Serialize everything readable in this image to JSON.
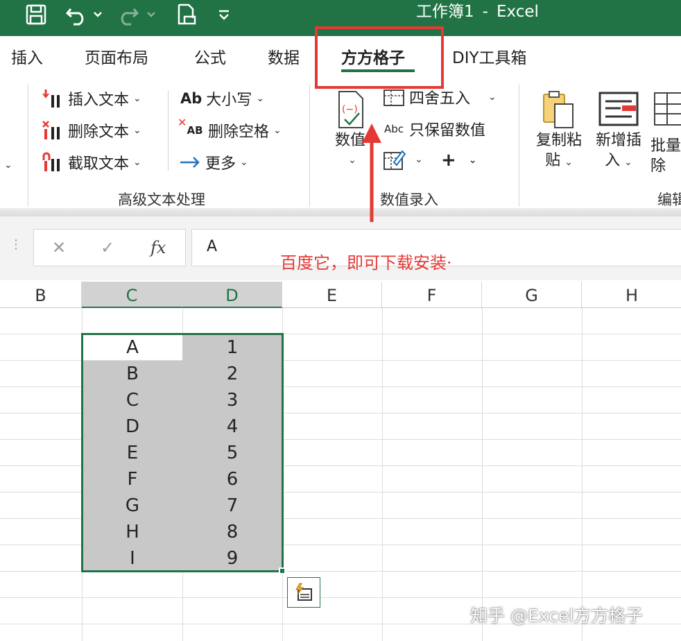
{
  "titlebar": {
    "title": "工作簿1",
    "separator": "-",
    "app": "Excel",
    "bg": "#217346"
  },
  "tabs": [
    {
      "label": "插入"
    },
    {
      "label": "页面布局"
    },
    {
      "label": "公式"
    },
    {
      "label": "数据"
    },
    {
      "label": "方方格子",
      "active": true
    },
    {
      "label": "DIY工具箱"
    }
  ],
  "ribbon": {
    "text_group": {
      "items": [
        "插入文本",
        "删除文本",
        "截取文本"
      ],
      "items2": [
        "大小写",
        "删除空格",
        "更多"
      ],
      "label": "高级文本处理"
    },
    "number_group": {
      "big_label": "数值",
      "round_label": "四舍五入",
      "keep_label": "只保留数值",
      "abc_icon_text": "Abc",
      "ab_icon_text": "Ab",
      "ab_small_icon_text": "AB",
      "plus": "+",
      "label": "数值录入"
    },
    "edit_group": {
      "copy_paste": [
        "复制粘",
        "贴"
      ],
      "insert_new": [
        "新增插",
        "入"
      ],
      "batch_delete": [
        "批量",
        "除"
      ],
      "label": "编辑"
    }
  },
  "formula_bar": {
    "cancel": "✕",
    "enter": "✓",
    "fx": "fx",
    "value": "A"
  },
  "annotation": "百度它，即可下载安装·",
  "columns": [
    "B",
    "C",
    "D",
    "E",
    "F",
    "G",
    "H"
  ],
  "selected_columns": [
    "C",
    "D"
  ],
  "cells": [
    {
      "c": "A",
      "d": "1"
    },
    {
      "c": "B",
      "d": "2"
    },
    {
      "c": "C",
      "d": "3"
    },
    {
      "c": "D",
      "d": "4"
    },
    {
      "c": "E",
      "d": "5"
    },
    {
      "c": "F",
      "d": "6"
    },
    {
      "c": "G",
      "d": "7"
    },
    {
      "c": "H",
      "d": "8"
    },
    {
      "c": "I",
      "d": "9"
    }
  ],
  "watermark": "知乎 @Excel方方格子",
  "colors": {
    "accent": "#217346",
    "highlight": "#e53935",
    "selection_fill": "#c8c8c8"
  }
}
